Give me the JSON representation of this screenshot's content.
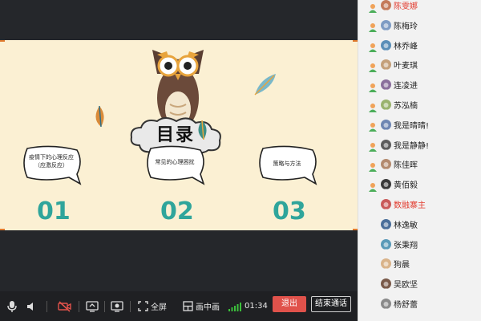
{
  "slide": {
    "title": "目录",
    "items": [
      {
        "text": "疫情下的心理反应（应激反应）",
        "number": "01"
      },
      {
        "text": "常见的心理困扰",
        "number": "02"
      },
      {
        "text": "策略与方法",
        "number": "03"
      }
    ]
  },
  "toolbar": {
    "mic_icon": "microphone-icon",
    "speaker_icon": "speaker-icon",
    "camera_off_icon": "camera-off-icon",
    "share_icon": "screen-share-icon",
    "record_icon": "record-icon",
    "fullscreen_label": "全屏",
    "pip_label": "画中画",
    "elapsed": "01:34",
    "exit_label": "退出",
    "end_label": "结束通话"
  },
  "participants": [
    {
      "name": "陈雯娜",
      "highlight": true,
      "sub": false
    },
    {
      "name": "陈梅玲",
      "highlight": false,
      "sub": false
    },
    {
      "name": "林乔峰",
      "highlight": false,
      "sub": false
    },
    {
      "name": "叶麦琪",
      "highlight": false,
      "sub": false
    },
    {
      "name": "连凌进",
      "highlight": false,
      "sub": false
    },
    {
      "name": "苏泓楠",
      "highlight": false,
      "sub": false
    },
    {
      "name": "我是晴晴!",
      "highlight": false,
      "sub": false
    },
    {
      "name": "我是静静!",
      "highlight": false,
      "sub": false
    },
    {
      "name": "陈佳晖",
      "highlight": false,
      "sub": false
    },
    {
      "name": "黄佰毅",
      "highlight": false,
      "sub": false
    },
    {
      "name": "数融寨主",
      "highlight": true,
      "sub": true
    },
    {
      "name": "林逸敏",
      "highlight": false,
      "sub": true
    },
    {
      "name": "张秉翔",
      "highlight": false,
      "sub": true
    },
    {
      "name": "狗晨",
      "highlight": false,
      "sub": true
    },
    {
      "name": "吴欧坚",
      "highlight": false,
      "sub": true
    },
    {
      "name": "杨舒蕾",
      "highlight": false,
      "sub": true
    }
  ],
  "colors": {
    "accent_red": "#e0524b",
    "number_teal": "#2fa59b",
    "slide_bg": "#fbf0d3",
    "signal_green": "#3bbf3b"
  }
}
